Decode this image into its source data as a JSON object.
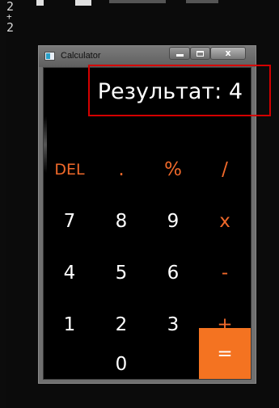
{
  "console": {
    "lines": [
      "2",
      "+",
      "2"
    ]
  },
  "window": {
    "title": "Calculator",
    "controls": {
      "minimize": "",
      "maximize": "",
      "close": "x"
    }
  },
  "display": {
    "result": "Результат: 4"
  },
  "keys": {
    "del": "DEL",
    "dot": ".",
    "percent": "%",
    "divide": "/",
    "seven": "7",
    "eight": "8",
    "nine": "9",
    "multiply": "x",
    "four": "4",
    "five": "5",
    "six": "6",
    "minus": "-",
    "one": "1",
    "two": "2",
    "three": "3",
    "plus": "+",
    "zero": "0",
    "equals": "="
  },
  "colors": {
    "accent": "#f47321",
    "operator_text": "#f0692a",
    "highlight": "#d40000",
    "background": "#000000"
  }
}
